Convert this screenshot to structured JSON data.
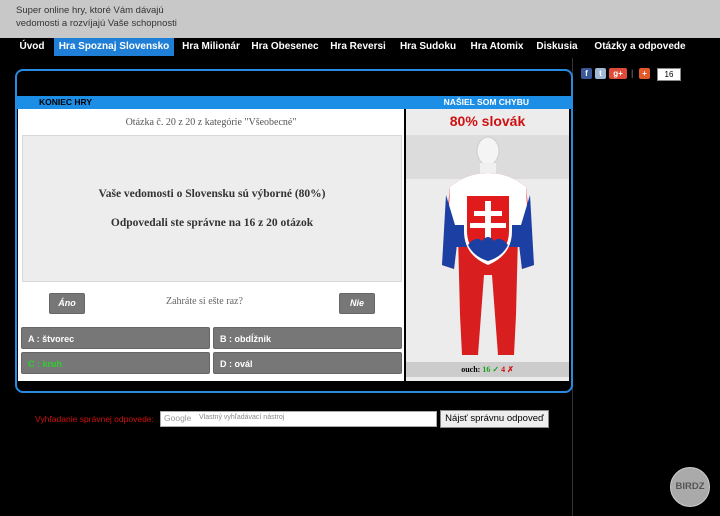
{
  "header": {
    "tagline_line1": "Super online hry, ktoré Vám dávajú",
    "tagline_line2": "vedomosti a rozvíjajú Vaše schopnosti"
  },
  "nav": {
    "items": [
      {
        "label": "Úvod"
      },
      {
        "label": "Hra Spoznaj Slovensko"
      },
      {
        "label": "Hra Milionár"
      },
      {
        "label": "Hra Obesenec"
      },
      {
        "label": "Hra Reversi"
      },
      {
        "label": "Hra Sudoku"
      },
      {
        "label": "Hra Atomix"
      },
      {
        "label": "Diskusia"
      },
      {
        "label": "Otázky a odpovede"
      }
    ],
    "active_index": 1
  },
  "game": {
    "end_label": "KONIEC HRY",
    "bug_label": "NAŠIEL SOM CHYBU",
    "question_title": "Otázka č. 20 z 20 z kategórie \"Všeobecné\"",
    "result_line1": "Vaše vedomosti o Slovensku sú výborné (80%)",
    "result_line2": "Odpovedali ste správne na 16 z 20 otázok",
    "play_again": "Zahráte si ešte raz?",
    "yes_label": "Áno",
    "no_label": "Nie",
    "answers": [
      {
        "label": "A : štvorec"
      },
      {
        "label": "B : obdĺžnik"
      },
      {
        "label": "C : kruh"
      },
      {
        "label": "D : ovál"
      }
    ],
    "correct_answer": "C : kruh",
    "percent_label": "80% slovák",
    "score": {
      "prefix": "ouch:",
      "correct": "16",
      "correct_mark": "✓",
      "wrong": "4",
      "wrong_mark": "✗"
    }
  },
  "search": {
    "label": "Vyhľadanie správnej odpovede:",
    "google_label": "Google",
    "placeholder": "Vlastný vyhľadávací nástroj",
    "button_label": "Nájsť správnu odpoveď"
  },
  "social": {
    "count": "16"
  },
  "watermark": "BIRDZ",
  "colors": {
    "accent_blue": "#1d8ee6",
    "red": "#d01010",
    "green": "#1aa31a"
  }
}
